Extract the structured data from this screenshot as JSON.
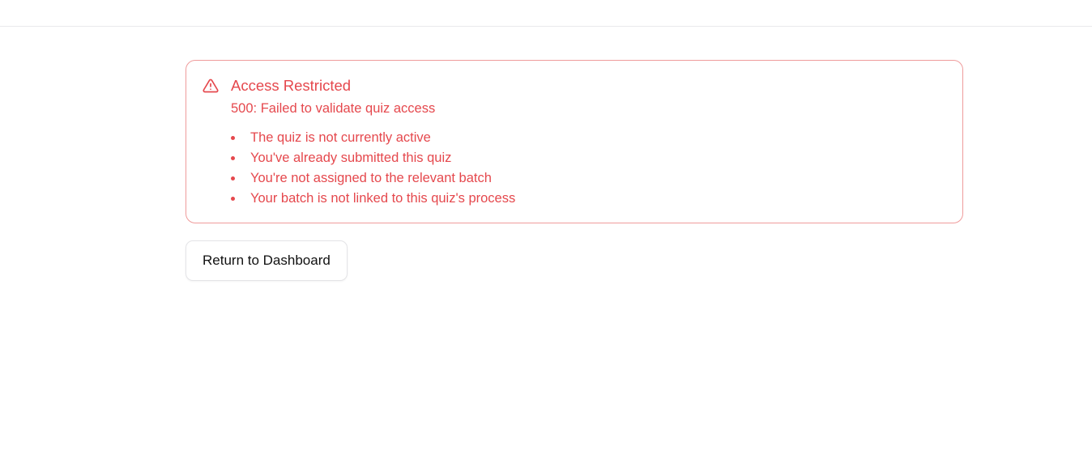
{
  "alert": {
    "title": "Access Restricted",
    "description": "500: Failed to validate quiz access",
    "icon": "warning-triangle-icon",
    "color": "#e5484d",
    "border_color": "#ef9b9b",
    "reasons": [
      "The quiz is not currently active",
      "You've already submitted this quiz",
      "You're not assigned to the relevant batch",
      "Your batch is not linked to this quiz's process"
    ]
  },
  "actions": {
    "return_label": "Return to Dashboard"
  }
}
